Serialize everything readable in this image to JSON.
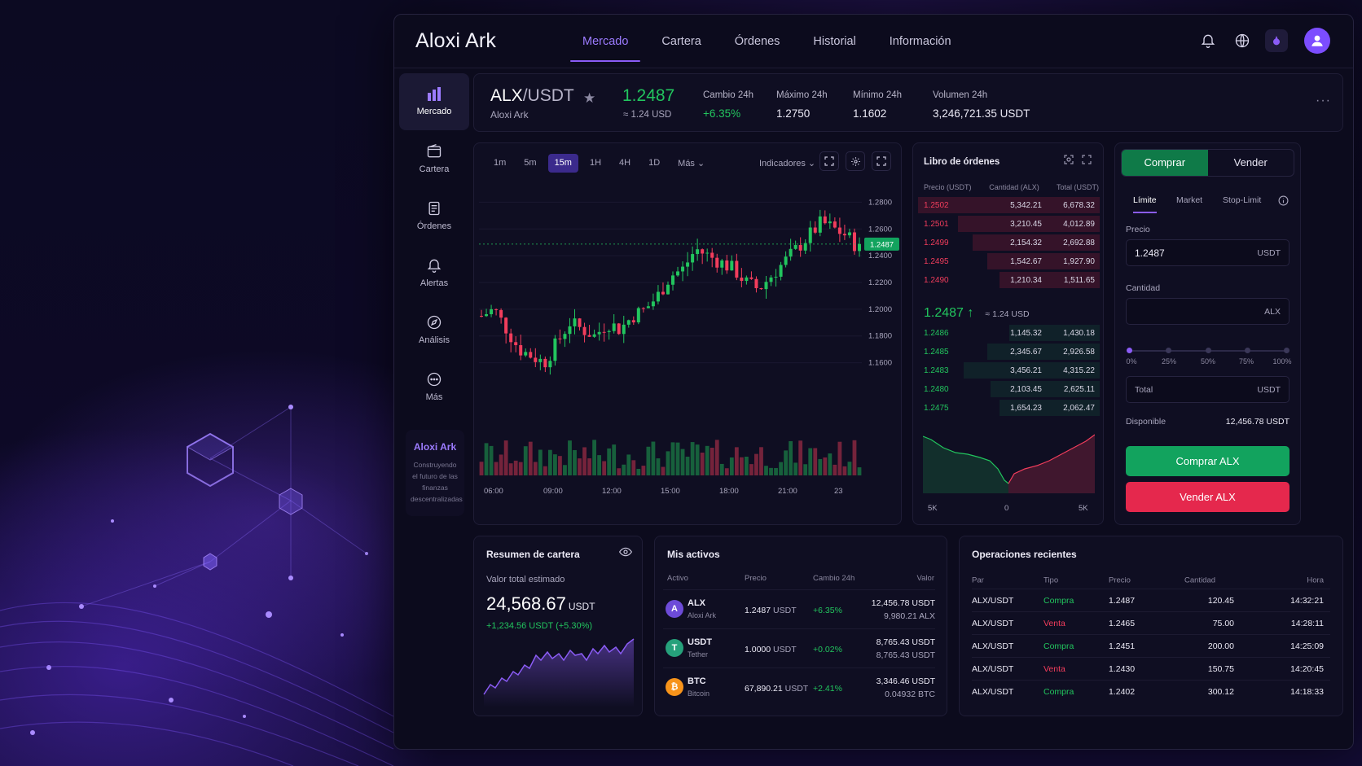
{
  "app": {
    "brand": "Aloxi Ark"
  },
  "nav": [
    "Mercado",
    "Cartera",
    "Órdenes",
    "Historial",
    "Información"
  ],
  "nav_active": "Mercado",
  "top_icons": [
    "bell-icon",
    "globe-icon",
    "theme-icon",
    "user-icon"
  ],
  "sidebar": {
    "items": [
      {
        "label": "Mercado",
        "icon": "bar-chart-icon"
      },
      {
        "label": "Cartera",
        "icon": "wallet-icon"
      },
      {
        "label": "Órdenes",
        "icon": "document-icon"
      },
      {
        "label": "Alertas",
        "icon": "bell-icon"
      },
      {
        "label": "Análisis",
        "icon": "compass-icon"
      },
      {
        "label": "Más",
        "icon": "more-icon"
      }
    ],
    "promo_title": "Aloxi Ark",
    "promo_text": "Construyendo el futuro de las finanzas descentralizadas"
  },
  "ticker": {
    "base": "ALX",
    "quote": "/USDT",
    "name": "Aloxi Ark",
    "price": "1.2487",
    "price_usd": "≈ 1.24 USD",
    "stats": [
      {
        "label": "Cambio 24h",
        "value": "+6.35%"
      },
      {
        "label": "Máximo 24h",
        "value": "1.2750"
      },
      {
        "label": "Mínimo 24h",
        "value": "1.1602"
      },
      {
        "label": "Volumen 24h",
        "value": "3,246,721.35 USDT"
      }
    ],
    "more": "···"
  },
  "chart": {
    "timeframes": [
      "1m",
      "5m",
      "15m",
      "1H",
      "4H",
      "1D",
      "Más"
    ],
    "active_timeframe": "15m",
    "indicators": "Indicadores",
    "price_badge": "1.2487",
    "y_ticks": [
      "1.2800",
      "1.2600",
      "1.2400",
      "1.2200",
      "1.2000",
      "1.1800",
      "1.1600"
    ],
    "x_ticks": [
      "06:00",
      "09:00",
      "12:00",
      "15:00",
      "18:00",
      "21:00",
      "23"
    ]
  },
  "chart_data": {
    "type": "candlestick",
    "ylim": [
      1.15,
      1.29
    ],
    "last_price": 1.2487,
    "close_path": [
      1.195,
      1.2,
      1.185,
      1.17,
      1.165,
      1.16,
      1.175,
      1.19,
      1.185,
      1.18,
      1.19,
      1.185,
      1.195,
      1.2,
      1.21,
      1.225,
      1.23,
      1.245,
      1.24,
      1.235,
      1.23,
      1.22,
      1.215,
      1.225,
      1.235,
      1.245,
      1.255,
      1.265,
      1.26,
      1.255,
      1.245
    ]
  },
  "orderbook": {
    "title": "Libro de órdenes",
    "headers": [
      "Precio (USDT)",
      "Cantidad (ALX)",
      "Total (USDT)"
    ],
    "asks": [
      {
        "p": "1.2502",
        "q": "5,342.21",
        "t": "6,678.32",
        "d": 1.0
      },
      {
        "p": "1.2501",
        "q": "3,210.45",
        "t": "4,012.89",
        "d": 0.78
      },
      {
        "p": "1.2499",
        "q": "2,154.32",
        "t": "2,692.88",
        "d": 0.7
      },
      {
        "p": "1.2495",
        "q": "1,542.67",
        "t": "1,927.90",
        "d": 0.62
      },
      {
        "p": "1.2490",
        "q": "1,210.34",
        "t": "1,511.65",
        "d": 0.55
      }
    ],
    "mid_price": "1.2487 ↑",
    "mid_usd": "≈ 1.24 USD",
    "bids": [
      {
        "p": "1.2486",
        "q": "1,145.32",
        "t": "1,430.18",
        "d": 0.5
      },
      {
        "p": "1.2485",
        "q": "2,345.67",
        "t": "2,926.58",
        "d": 0.62
      },
      {
        "p": "1.2483",
        "q": "3,456.21",
        "t": "4,315.22",
        "d": 0.75
      },
      {
        "p": "1.2480",
        "q": "2,103.45",
        "t": "2,625.11",
        "d": 0.6
      },
      {
        "p": "1.2475",
        "q": "1,654.23",
        "t": "2,062.47",
        "d": 0.55
      }
    ],
    "depth_axis": [
      "5K",
      "0",
      "5K"
    ]
  },
  "trade": {
    "buy_tab": "Comprar",
    "sell_tab": "Vender",
    "order_types": [
      "Límite",
      "Market",
      "Stop-Limit"
    ],
    "price_label": "Precio",
    "price_value": "1.2487",
    "price_unit": "USDT",
    "qty_label": "Cantidad",
    "qty_unit": "ALX",
    "percents": [
      "0%",
      "25%",
      "50%",
      "75%",
      "100%"
    ],
    "slider_value": 0,
    "total_label": "Total",
    "total_unit": "USDT",
    "avail_label": "Disponible",
    "avail_value": "12,456.78 USDT",
    "buy_button": "Comprar ALX",
    "sell_button": "Vender ALX"
  },
  "wallet": {
    "title": "Resumen de cartera",
    "label": "Valor total estimado",
    "value": "24,568.67",
    "unit": "USDT",
    "change": "+1,234.56 USDT (+5.30%)"
  },
  "assets": {
    "title": "Mis activos",
    "headers": [
      "Activo",
      "Precio",
      "Cambio 24h",
      "Valor"
    ],
    "rows": [
      {
        "sym": "ALX",
        "name": "Aloxi Ark",
        "glyph": "A",
        "color": "#6d4bd8",
        "price": "1.2487",
        "unit": "USDT",
        "chg": "+6.35%",
        "v1": "12,456.78 USDT",
        "v2": "9,980.21 ALX"
      },
      {
        "sym": "USDT",
        "name": "Tether",
        "glyph": "T",
        "color": "#26a17b",
        "price": "1.0000",
        "unit": "USDT",
        "chg": "+0.02%",
        "v1": "8,765.43 USDT",
        "v2": "8,765.43 USDT"
      },
      {
        "sym": "BTC",
        "name": "Bitcoin",
        "glyph": "₿",
        "color": "#f7931a",
        "price": "67,890.21",
        "unit": "USDT",
        "chg": "+2.41%",
        "v1": "3,346.46 USDT",
        "v2": "0.04932 BTC"
      }
    ]
  },
  "ops": {
    "title": "Operaciones recientes",
    "headers": [
      "Par",
      "Tipo",
      "Precio",
      "Cantidad",
      "Hora"
    ],
    "rows": [
      {
        "pair": "ALX/USDT",
        "type": "Compra",
        "side": "buy",
        "price": "1.2487",
        "qty": "120.45",
        "time": "14:32:21"
      },
      {
        "pair": "ALX/USDT",
        "type": "Venta",
        "side": "sell",
        "price": "1.2465",
        "qty": "75.00",
        "time": "14:28:11"
      },
      {
        "pair": "ALX/USDT",
        "type": "Compra",
        "side": "buy",
        "price": "1.2451",
        "qty": "200.00",
        "time": "14:25:09"
      },
      {
        "pair": "ALX/USDT",
        "type": "Venta",
        "side": "sell",
        "price": "1.2430",
        "qty": "150.75",
        "time": "14:20:45"
      },
      {
        "pair": "ALX/USDT",
        "type": "Compra",
        "side": "buy",
        "price": "1.2402",
        "qty": "300.12",
        "time": "14:18:33"
      }
    ]
  },
  "colors": {
    "accent": "#8b5cf6",
    "up": "#22c55e",
    "down": "#f23d5c",
    "buy": "#12a35e",
    "sell": "#e5284d"
  }
}
